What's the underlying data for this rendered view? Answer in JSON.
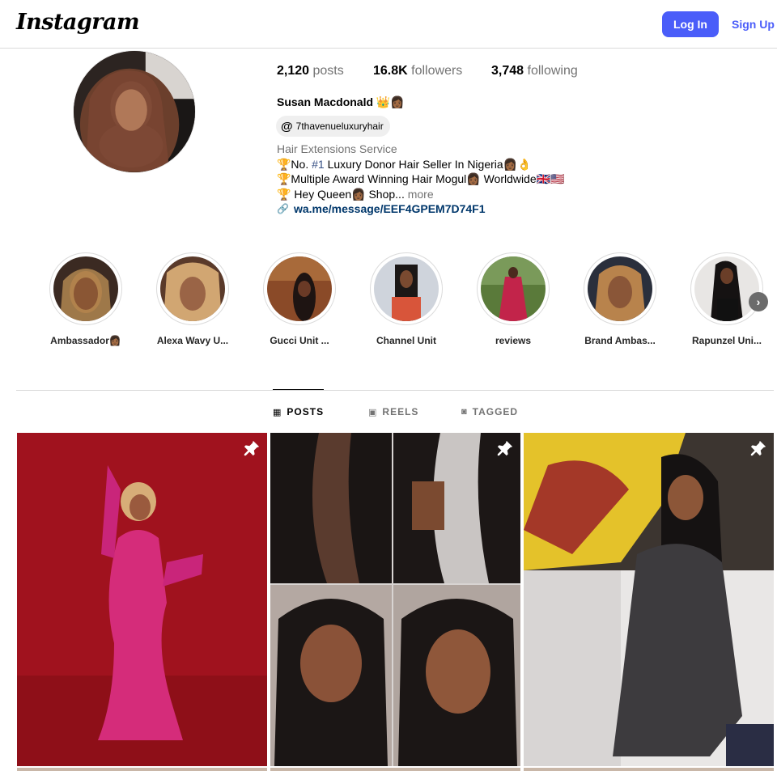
{
  "header": {
    "logo_text": "Instagram",
    "login_label": "Log In",
    "signup_label": "Sign Up"
  },
  "profile": {
    "avatar_alt": "Susan Macdonald",
    "stats": {
      "posts_count": "2,120",
      "posts_label": "posts",
      "followers_count": "16.8K",
      "followers_label": "followers",
      "following_count": "3,748",
      "following_label": "following"
    },
    "name": "Susan Macdonald 👑👩🏾",
    "threads_handle": "7thavenueluxuryhair",
    "category": "Hair Extensions Service",
    "bio_line1_prefix": "🏆No. ",
    "bio_line1_hash": "#1",
    "bio_line1_suffix": " Luxury Donor Hair Seller In Nigeria👩🏾👌",
    "bio_line2": "🏆Multiple Award Winning Hair Mogul👩🏾 Worldwide🇬🇧🇺🇸",
    "bio_line3": "🏆 Hey Queen👩🏾 Shop...",
    "bio_more": " more",
    "link_text": "wa.me/message/EEF4GPEM7D74F1"
  },
  "highlights": [
    {
      "label": "Ambassador👩🏾"
    },
    {
      "label": "Alexa Wavy U..."
    },
    {
      "label": "Gucci Unit ..."
    },
    {
      "label": "Channel Unit"
    },
    {
      "label": "reviews"
    },
    {
      "label": "Brand Ambas..."
    },
    {
      "label": "Rapunzel Uni..."
    }
  ],
  "tabs": {
    "posts": "POSTS",
    "reels": "REELS",
    "tagged": "TAGGED"
  },
  "colors": {
    "accent": "#4a5df9",
    "link": "#00376b",
    "muted": "#737373",
    "border": "#dbdbdb"
  }
}
